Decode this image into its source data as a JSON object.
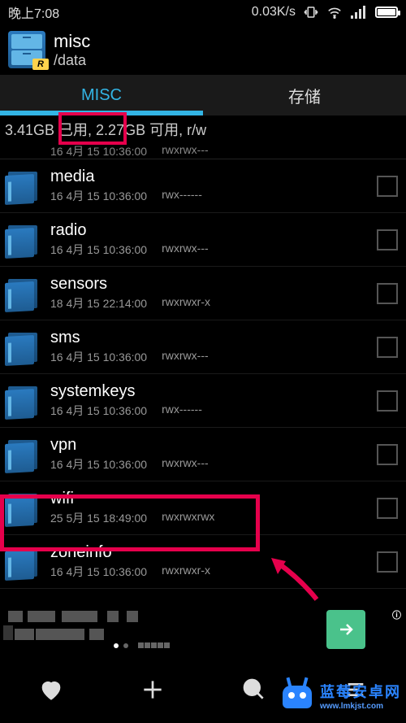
{
  "status": {
    "time": "晚上7:08",
    "net_speed": "0.03K/s"
  },
  "appbar": {
    "title": "misc",
    "subtitle": "/data",
    "icon_letter": "R"
  },
  "tabs": {
    "active": "MISC",
    "other": "存储"
  },
  "storage": "3.41GB 已用, 2.27GB 可用, r/w",
  "partial": {
    "date": "16 4月 15 10:36:00",
    "perm": "rwxrwx---"
  },
  "files": [
    {
      "name": "media",
      "date": "16 4月 15 10:36:00",
      "perm": "rwx------"
    },
    {
      "name": "radio",
      "date": "16 4月 15 10:36:00",
      "perm": "rwxrwx---"
    },
    {
      "name": "sensors",
      "date": "18 4月 15 22:14:00",
      "perm": "rwxrwxr-x"
    },
    {
      "name": "sms",
      "date": "16 4月 15 10:36:00",
      "perm": "rwxrwx---"
    },
    {
      "name": "systemkeys",
      "date": "16 4月 15 10:36:00",
      "perm": "rwx------"
    },
    {
      "name": "vpn",
      "date": "16 4月 15 10:36:00",
      "perm": "rwxrwx---"
    },
    {
      "name": "wifi",
      "date": "25 5月 15 18:49:00",
      "perm": "rwxrwxrwx"
    },
    {
      "name": "zoneinfo",
      "date": "16 4月 15 10:36:00",
      "perm": "rwxrwxr-x"
    }
  ],
  "ad": {
    "badge": "ⓘ"
  },
  "watermark": {
    "cn": "蓝莓安卓网",
    "url": "www.lmkjst.com"
  }
}
